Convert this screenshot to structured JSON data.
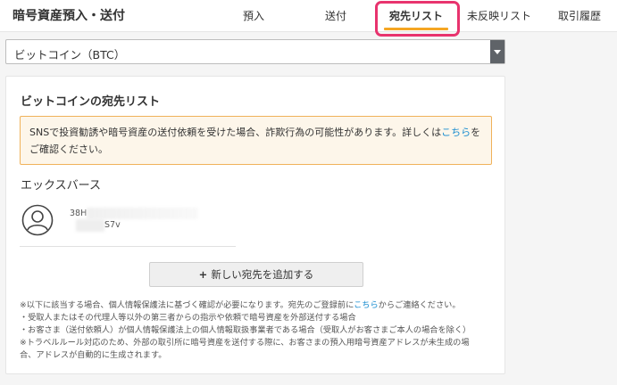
{
  "header": {
    "title": "暗号資産預入・送付",
    "tabs": [
      {
        "label": "預入"
      },
      {
        "label": "送付"
      },
      {
        "label": "宛先リスト"
      },
      {
        "label": "未反映リスト"
      },
      {
        "label": "取引履歴"
      }
    ],
    "active_tab": "宛先リスト"
  },
  "currency_select": {
    "value": "ビットコイン（BTC）"
  },
  "card": {
    "title": "ビットコインの宛先リスト",
    "warning": {
      "text_before": "SNSで投資勧誘や暗号資産の送付依頼を受けた場合、詐欺行為の可能性があります。詳しくは",
      "link": "こちら",
      "text_after": "をご確認ください。"
    },
    "contact": {
      "name": "エックスバース",
      "address_prefix": "38H",
      "address_suffix": "S7v"
    },
    "add_button_label": "新しい宛先を追加する",
    "notes": {
      "line1_before": "※以下に該当する場合、個人情報保護法に基づく確認が必要になります。宛先のご登録前に",
      "line1_link": "こちら",
      "line1_after": "からご連絡ください。",
      "line2": "・受取人またはその代理人等以外の第三者からの指示や依頼で暗号資産を外部送付する場合",
      "line3": "・お客さま（送付依頼人）が個人情報保護法上の個人情報取扱事業者である場合（受取人がお客さまご本人の場合を除く）",
      "line4": "※トラベルルール対応のため、外部の取引所に暗号資産を送付する際に、お客さまの預入用暗号資産アドレスが未生成の場",
      "line5": "合、アドレスが自動的に生成されます。"
    }
  },
  "colors": {
    "accent_underline": "#f5a623",
    "highlight_border": "#e8336e",
    "link": "#1a8dd0",
    "warning_border": "#f0b25a",
    "warning_bg": "#fdf6ea"
  }
}
